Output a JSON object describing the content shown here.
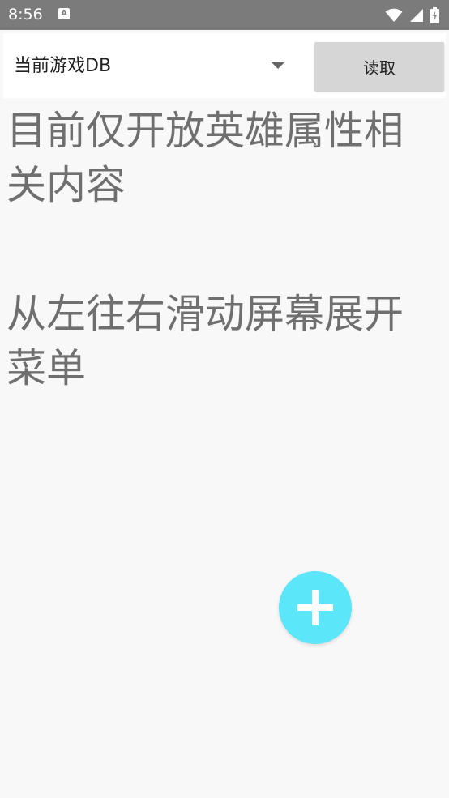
{
  "status_bar": {
    "time": "8:56",
    "app_icon_letter": "A"
  },
  "toolbar": {
    "spinner_value": "当前游戏DB",
    "read_button_label": "读取"
  },
  "content": {
    "paragraph_1": "目前仅开放英雄属性相关内容",
    "paragraph_2": "从左往右滑动屏幕展开菜单"
  },
  "fab": {
    "icon": "plus-icon",
    "color": "#5be6f9"
  },
  "colors": {
    "status_bar": "#7b7b7b",
    "background": "#f8f8f8",
    "button": "#d6d6d6",
    "text": "#6f6f6f"
  }
}
